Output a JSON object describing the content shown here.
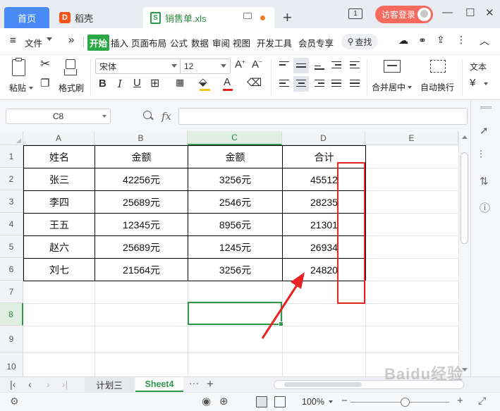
{
  "titlebar": {
    "tab_home": "首页",
    "tab_daoke": "稻壳",
    "tab_file": "销售单.xls",
    "login": "访客登录",
    "badge": "1"
  },
  "menu": {
    "hamburger": "≡",
    "file": "文件",
    "more": "»",
    "items": [
      "开始",
      "插入",
      "页面布局",
      "公式",
      "数据",
      "审阅",
      "视图",
      "开发工具",
      "会员专享"
    ],
    "search": "查找"
  },
  "toolbar": {
    "paste": "粘贴",
    "format_painter": "格式刷",
    "font_name": "宋体",
    "font_size": "12",
    "merge_center": "合并居中",
    "wrap_text": "自动换行",
    "number_format": "文本"
  },
  "formula_bar": {
    "cell_ref": "C8",
    "fx": "fx",
    "formula": ""
  },
  "grid": {
    "columns": [
      "A",
      "B",
      "C",
      "D",
      "E"
    ],
    "rows": [
      "1",
      "2",
      "3",
      "4",
      "5",
      "6",
      "7",
      "8",
      "9",
      "10"
    ],
    "header": [
      "姓名",
      "金额",
      "金额",
      "合计"
    ],
    "data": [
      [
        "张三",
        "42256元",
        "3256元",
        "45512"
      ],
      [
        "李四",
        "25689元",
        "2546元",
        "28235"
      ],
      [
        "王五",
        "12345元",
        "8956元",
        "21301"
      ],
      [
        "赵六",
        "25689元",
        "1245元",
        "26934"
      ],
      [
        "刘七",
        "21564元",
        "3256元",
        "24820"
      ]
    ]
  },
  "sheets": {
    "tabs": [
      "计划三",
      "Sheet4"
    ],
    "active": "Sheet4"
  },
  "status": {
    "zoom": "100%"
  },
  "watermark": "Baidu经验",
  "colors": {
    "accent_green": "#2aa845",
    "home_tab_blue": "#4a8af4",
    "login_red": "#f26b5e",
    "annotation_red": "#e8221f"
  }
}
